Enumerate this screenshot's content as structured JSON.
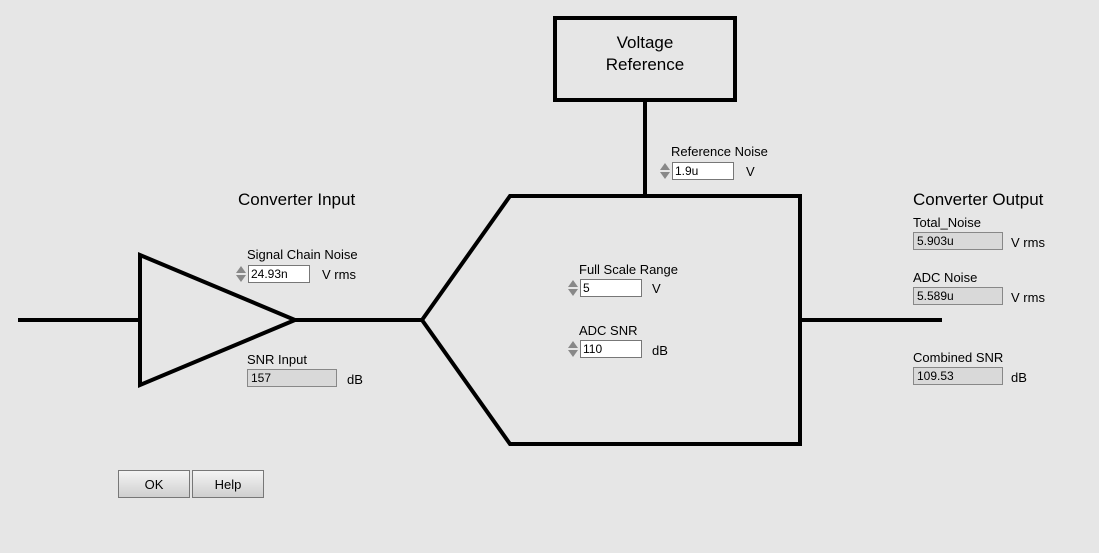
{
  "voltage_reference": {
    "title_line1": "Voltage",
    "title_line2": "Reference"
  },
  "reference_noise": {
    "label": "Reference Noise",
    "value": "1.9u",
    "unit": "V"
  },
  "converter_input": {
    "heading": "Converter Input",
    "signal_chain_noise": {
      "label": "Signal Chain Noise",
      "value": "24.93n",
      "unit": "V rms"
    },
    "snr_input": {
      "label": "SNR Input",
      "value": "157",
      "unit": "dB"
    }
  },
  "adc_block": {
    "full_scale_range": {
      "label": "Full Scale Range",
      "value": "5",
      "unit": "V"
    },
    "adc_snr": {
      "label": "ADC SNR",
      "value": "110",
      "unit": "dB"
    }
  },
  "converter_output": {
    "heading": "Converter Output",
    "total_noise": {
      "label": "Total_Noise",
      "value": "5.903u",
      "unit": "V rms"
    },
    "adc_noise": {
      "label": "ADC Noise",
      "value": "5.589u",
      "unit": "V rms"
    },
    "combined_snr": {
      "label": "Combined SNR",
      "value": "109.53",
      "unit": "dB"
    }
  },
  "buttons": {
    "ok": "OK",
    "help": "Help"
  }
}
